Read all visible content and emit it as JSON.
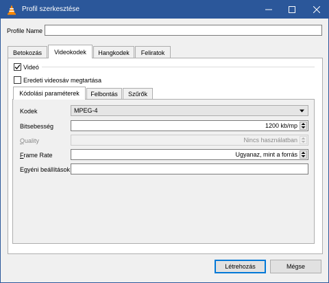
{
  "window": {
    "title": "Profil szerkesztése",
    "title_bar_color": "#2b579a",
    "controls": [
      "minimize-icon",
      "maximize-icon",
      "close-icon"
    ]
  },
  "profile": {
    "label": "Profile Name",
    "value": ""
  },
  "tabs": [
    {
      "label": "Betokozás",
      "active": false
    },
    {
      "label": "Videokodek",
      "active": true
    },
    {
      "label": "Hangkodek",
      "active": false
    },
    {
      "label": "Feliratok",
      "active": false
    }
  ],
  "video": {
    "video_checkbox_label": "Videó",
    "video_checked": true,
    "keep_original_label": "Eredeti videosáv megtartása",
    "keep_original_checked": false
  },
  "subtabs": [
    {
      "label": "Kódolási paraméterek",
      "active": true
    },
    {
      "label": "Felbontás",
      "active": false
    },
    {
      "label": "Szűrők",
      "active": false
    }
  ],
  "encoding": {
    "codec_label": "Kodek",
    "codec_value": "MPEG-4",
    "bitrate_label": "Bitsebesség",
    "bitrate_value": "1200 kb/mp",
    "quality_label": "Quality",
    "quality_value": "Nincs használatban",
    "framerate_label": "Frame Rate",
    "framerate_value": "Ugyanaz, mint a forrás",
    "custom_label": "Egyéni beállítások",
    "custom_value": ""
  },
  "buttons": {
    "create": "Létrehozás",
    "cancel": "Mégse"
  }
}
